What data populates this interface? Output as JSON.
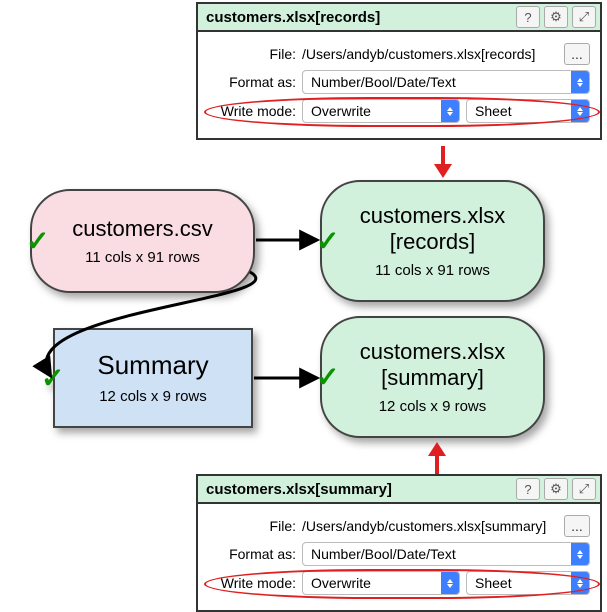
{
  "panel_top": {
    "title": "customers.xlsx[records]",
    "file_label": "File:",
    "file_value": "/Users/andyb/customers.xlsx[records]",
    "format_label": "Format as:",
    "format_value": "Number/Bool/Date/Text",
    "write_label": "Write mode:",
    "write_value": "Overwrite",
    "sheet_value": "Sheet",
    "more": "..."
  },
  "panel_bottom": {
    "title": "customers.xlsx[summary]",
    "file_label": "File:",
    "file_value": "/Users/andyb/customers.xlsx[summary]",
    "format_label": "Format as:",
    "format_value": "Number/Bool/Date/Text",
    "write_label": "Write mode:",
    "write_value": "Overwrite",
    "sheet_value": "Sheet",
    "more": "..."
  },
  "nodes": {
    "csv": {
      "title": "customers.csv",
      "sub": "11 cols x 91 rows"
    },
    "xlsx_records": {
      "title": "customers.xlsx\n[records]",
      "sub": "11 cols x 91 rows"
    },
    "summary": {
      "title": "Summary",
      "sub": "12 cols x 9 rows"
    },
    "xlsx_summary": {
      "title": "customers.xlsx\n[summary]",
      "sub": "12 cols x 9 rows"
    }
  },
  "icons": {
    "help": "?",
    "gear": "⚙",
    "expand": "⤢",
    "check": "✓"
  }
}
